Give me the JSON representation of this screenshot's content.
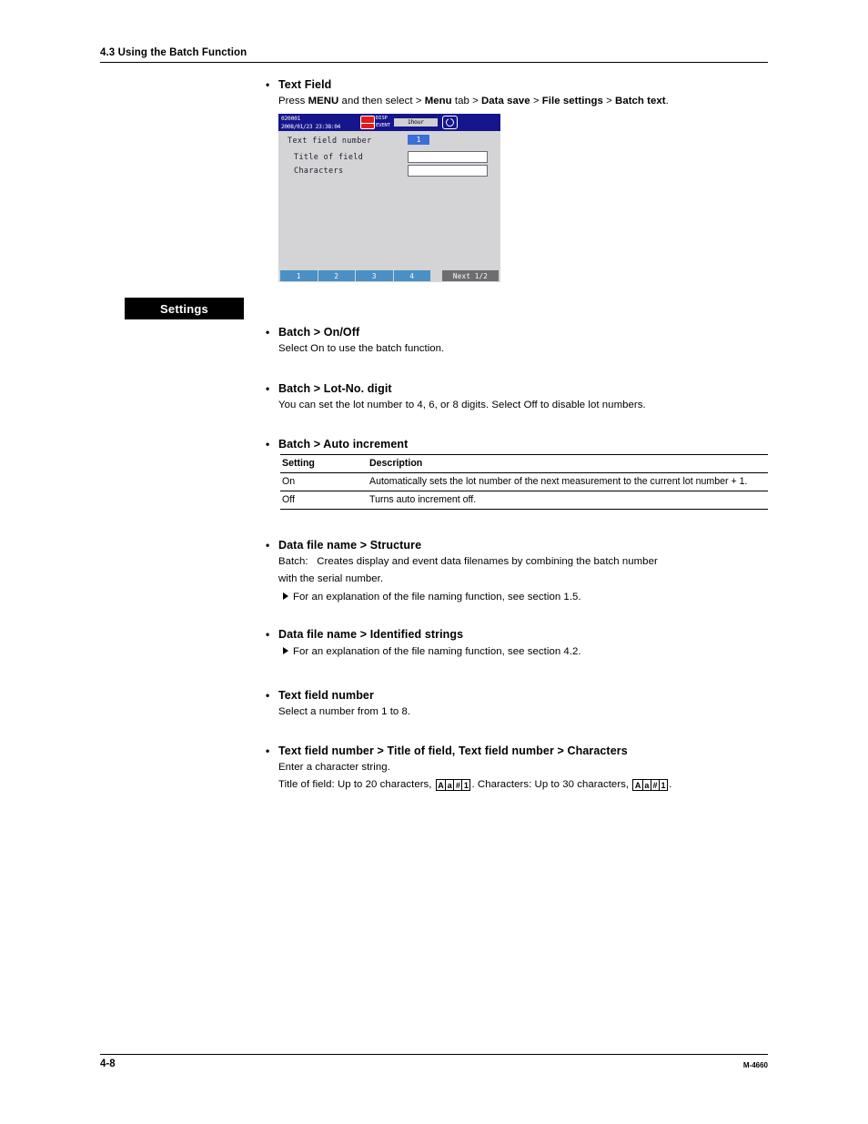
{
  "header": {
    "section_number": "4.3",
    "section_title": "Using the Batch Function",
    "full": "4.3  Using the Batch Function"
  },
  "text_field_section": {
    "bullet": "•",
    "heading": "Text Field",
    "path_prefix": "Press ",
    "path_menu_key": "MENU",
    "path_mid": " and then select > ",
    "path_menu_tab": "Menu",
    "path_tab_word": " tab > ",
    "path_data_save": "Data save",
    "sep1": " > ",
    "path_file_settings": "File settings",
    "sep2": " > ",
    "path_batch_text": "Batch text",
    "period": "."
  },
  "device_screen": {
    "batch_number": "020001",
    "datetime": "2008/01/23 23:38:04",
    "rec_icon": "rec-icon",
    "disp_label": "DISP",
    "event_label": "EVENT",
    "interval": "1hour",
    "circle_button_icon": "power-circle-icon",
    "rows": [
      {
        "label": "Text field number",
        "value": "1",
        "type": "selected-value"
      },
      {
        "label": "Title of field",
        "value": "",
        "type": "text-input"
      },
      {
        "label": "Characters",
        "value": "",
        "type": "text-input"
      }
    ],
    "tabs": [
      "1",
      "2",
      "3",
      "4"
    ],
    "next_label": "Next 1/2",
    "colors": {
      "topbar": "#15158c",
      "body": "#d4d4d6",
      "tab": "#4a90c4",
      "selected_value": "#3a6fd8",
      "next_button": "#6d6d70"
    }
  },
  "settings_badge": {
    "label": "Settings"
  },
  "settings_items": [
    {
      "bullet": "•",
      "heading": "Batch > On/Off",
      "body": "Select On to use the batch function."
    },
    {
      "bullet": "•",
      "heading": "Batch > Lot-No. digit",
      "body": "You can set the lot number to 4, 6, or 8 digits. Select Off to disable lot numbers."
    },
    {
      "bullet": "•",
      "heading": "Batch > Auto increment"
    }
  ],
  "auto_increment_table": {
    "columns": [
      "Setting",
      "Description"
    ],
    "rows": [
      {
        "setting": "On",
        "description": "Automatically sets the lot number of the next measurement to the current lot number + 1."
      },
      {
        "setting": "Off",
        "description": "Turns auto increment off."
      }
    ]
  },
  "structure_section": {
    "bullet": "•",
    "heading": "Data file name > Structure",
    "line1_label": "Batch:",
    "line1_text": "Creates display and event data filenames by combining the batch number",
    "line2_text": "with the serial number.",
    "note": "For an explanation of the file naming function, see section 1.5.",
    "note_icon": "triangle-right-icon"
  },
  "identified_strings_section": {
    "bullet": "•",
    "heading": "Data file name > Identified strings",
    "note": "For an explanation of the file naming function, see section 4.2.",
    "note_icon": "triangle-right-icon"
  },
  "text_field_number_section": {
    "bullet": "•",
    "heading": "Text field number",
    "body": "Select a number from 1 to 8."
  },
  "title_characters_section": {
    "bullet": "•",
    "heading": "Text field number > Title of field,  Text field number > Characters",
    "body": "Enter a character string.",
    "limits_part1": "Title of field: Up to 20 characters, ",
    "limits_part2": ". Characters: Up to 30 characters, ",
    "limits_part3": ".",
    "char_classes": [
      "A",
      "a",
      "#",
      "1"
    ]
  },
  "footer": {
    "page_number": "4-8",
    "manual_code": "M-4660"
  }
}
